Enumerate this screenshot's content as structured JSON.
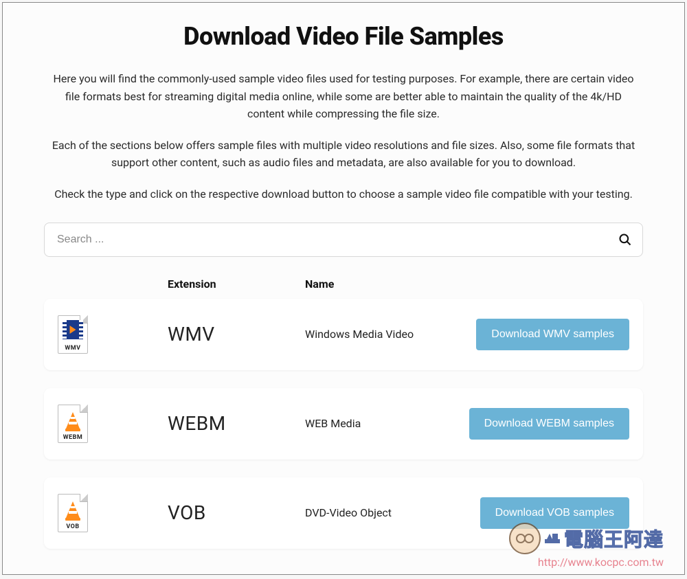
{
  "page_title": "Download Video File Samples",
  "intro": [
    "Here you will find the commonly-used sample video files used for testing purposes. For example, there are certain video file formats best for streaming digital media online, while some are better able to maintain the quality of the 4k/HD content while compressing the file size.",
    "Each of the sections below offers sample files with multiple video resolutions and file sizes. Also, some file formats that support other content, such as audio files and metadata, are also available for you to download.",
    "Check the type and click on the respective download button to choose a sample video file compatible with your testing."
  ],
  "search": {
    "placeholder": "Search ..."
  },
  "columns": {
    "extension": "Extension",
    "name": "Name"
  },
  "rows": [
    {
      "icon_label": "WMV",
      "icon_kind": "wmv",
      "extension": "WMV",
      "name": "Windows Media Video",
      "button": "Download WMV samples"
    },
    {
      "icon_label": "WEBM",
      "icon_kind": "cone",
      "extension": "WEBM",
      "name": "WEB Media",
      "button": "Download WEBM samples"
    },
    {
      "icon_label": "VOB",
      "icon_kind": "cone",
      "extension": "VOB",
      "name": "DVD-Video Object",
      "button": "Download VOB samples"
    }
  ],
  "watermark": {
    "text_cn": "電腦王阿達",
    "url": "http://www.kocpc.com.tw"
  }
}
